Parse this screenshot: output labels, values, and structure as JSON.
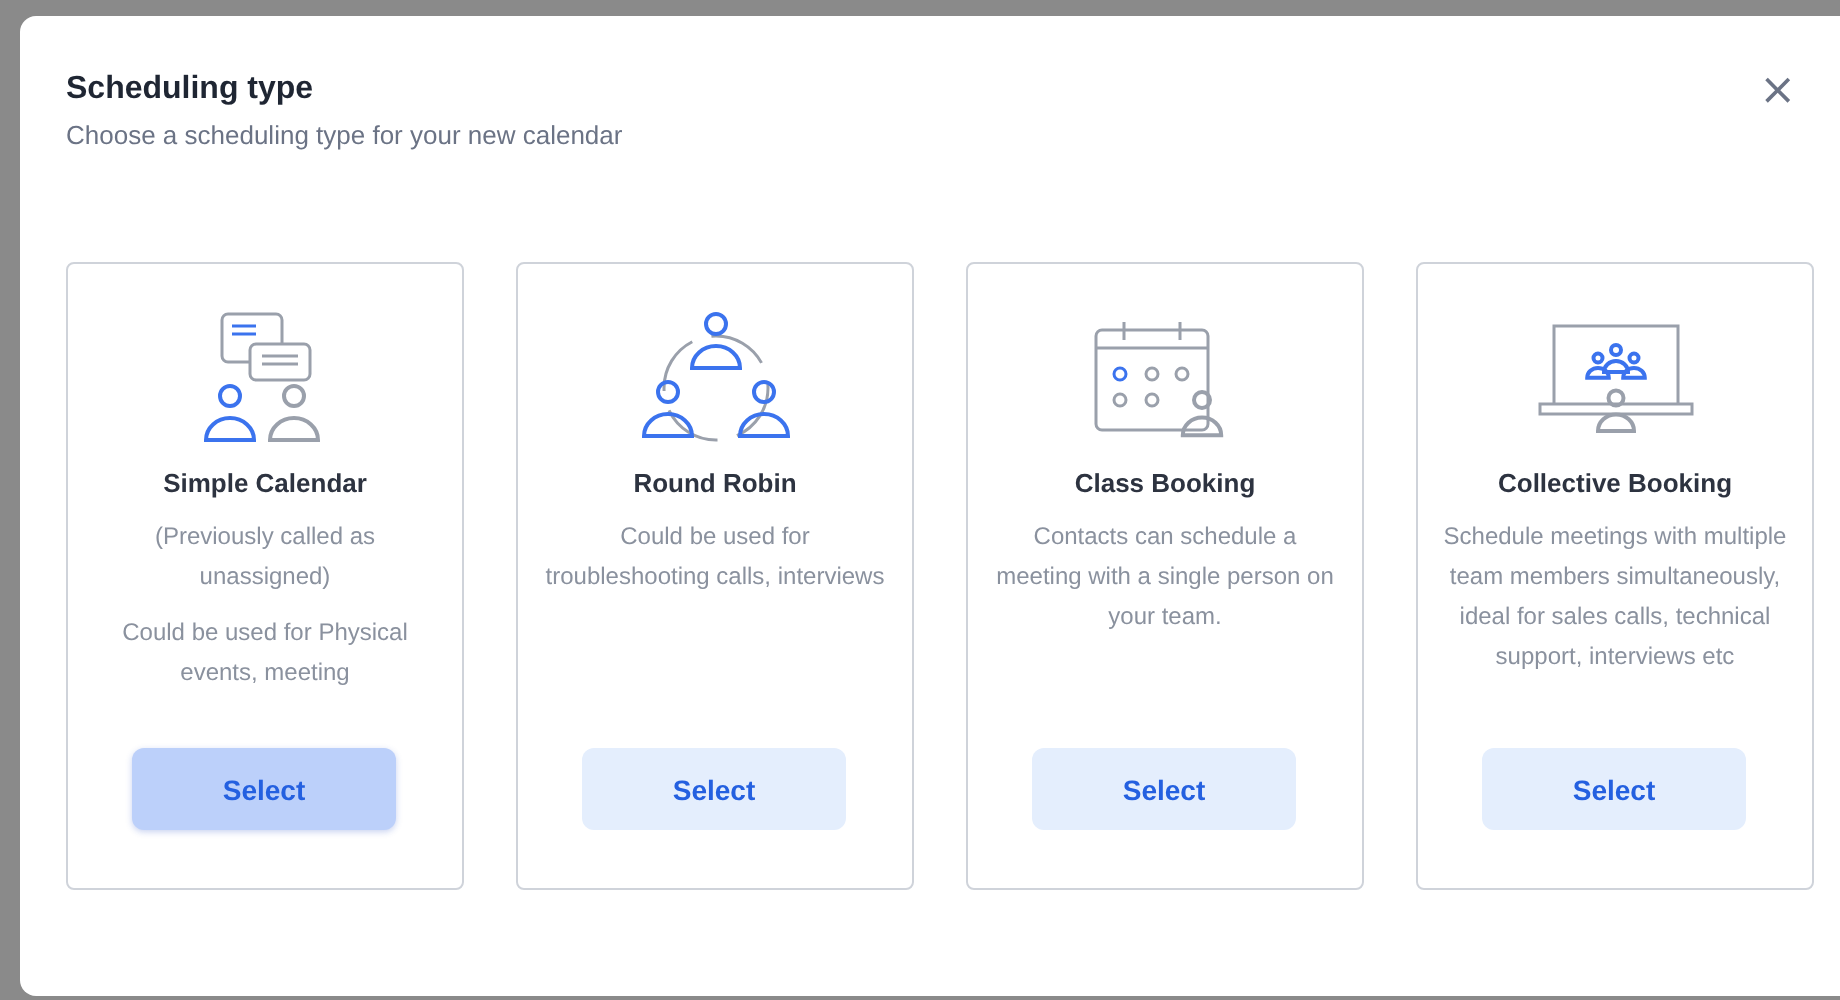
{
  "dialog": {
    "title": "Scheduling type",
    "subtitle": "Choose a scheduling type for your new calendar",
    "close": "×"
  },
  "cards": [
    {
      "kind": "chat",
      "title": "Simple Calendar",
      "descriptions": [
        "(Previously called as unassigned)",
        "Could be used for Physical events, meeting"
      ],
      "button": {
        "label": "Select",
        "highlighted": true
      }
    },
    {
      "kind": "cycle",
      "title": "Round Robin",
      "descriptions": [
        "Could be used for troubleshooting calls, interviews"
      ],
      "button": {
        "label": "Select",
        "highlighted": false
      }
    },
    {
      "kind": "calendar",
      "title": "Class Booking",
      "descriptions": [
        "Contacts can schedule a meeting with a single person on your team."
      ],
      "button": {
        "label": "Select",
        "highlighted": false
      }
    },
    {
      "kind": "screen",
      "title": "Collective Booking",
      "descriptions": [
        "Schedule meetings with multiple team members simultaneously, ideal for sales calls, technical support, interviews etc"
      ],
      "button": {
        "label": "Select",
        "highlighted": false
      }
    }
  ]
}
